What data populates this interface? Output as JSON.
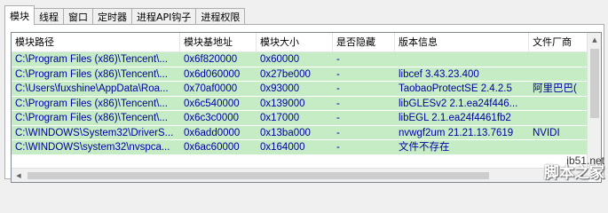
{
  "tabs": [
    {
      "label": "模块",
      "active": true
    },
    {
      "label": "线程",
      "active": false
    },
    {
      "label": "窗口",
      "active": false
    },
    {
      "label": "定时器",
      "active": false
    },
    {
      "label": "进程API钩子",
      "active": false
    },
    {
      "label": "进程权限",
      "active": false
    }
  ],
  "columns": [
    "模块路径",
    "模块基地址",
    "模块大小",
    "是否隐藏",
    "版本信息",
    "文件厂商"
  ],
  "rows": [
    [
      "C:\\Program Files (x86)\\Tencent\\...",
      "0x6f820000",
      "0x60000",
      "-",
      "",
      ""
    ],
    [
      "C:\\Program Files (x86)\\Tencent\\...",
      "0x6d060000",
      "0x27be000",
      "-",
      "libcef 3.43.23.400",
      ""
    ],
    [
      "C:\\Users\\fuxshine\\AppData\\Roa...",
      "0x70af0000",
      "0x93000",
      "-",
      "TaobaoProtectSE 2.4.2.5",
      "阿里巴巴("
    ],
    [
      "C:\\Program Files (x86)\\Tencent\\...",
      "0x6c540000",
      "0x139000",
      "-",
      "libGLESv2 2.1.ea24f446...",
      ""
    ],
    [
      "C:\\Program Files (x86)\\Tencent\\...",
      "0x6c3c0000",
      "0x17000",
      "-",
      "libEGL 2.1.ea24f4461fb2",
      ""
    ],
    [
      "C:\\WINDOWS\\System32\\DriverS...",
      "0x6add0000",
      "0x13ba000",
      "-",
      "nvwgf2um 21.21.13.7619",
      "NVIDI"
    ],
    [
      "C:\\WINDOWS\\system32\\nvspca...",
      "0x6ac60000",
      "0x164000",
      "-",
      "文件不存在",
      ""
    ]
  ],
  "row_color": "#c6ecc6",
  "text_color": "#0000a0",
  "watermark": {
    "url": "jb51.net",
    "text": "脚本之家"
  }
}
